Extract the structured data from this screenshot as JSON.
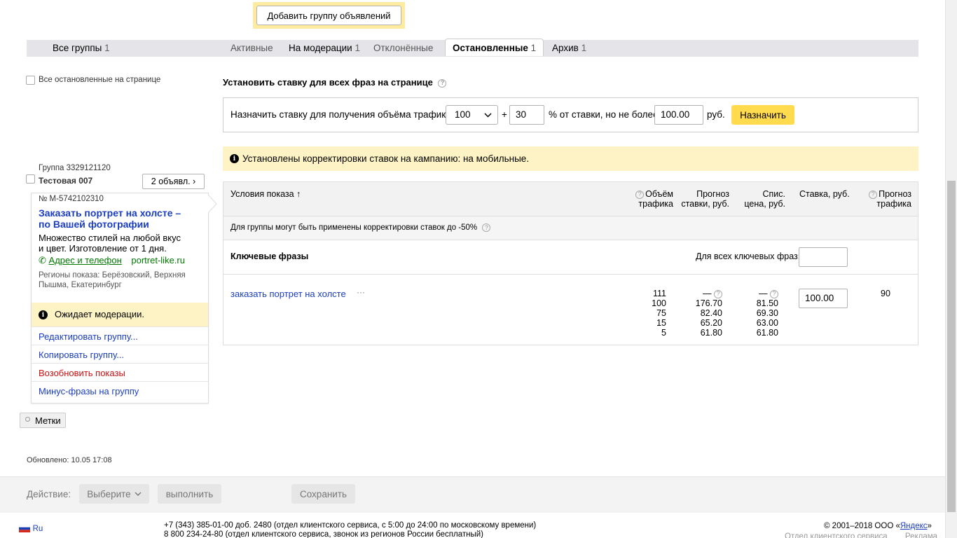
{
  "top": {
    "add_group_label": "Добавить группу объявлений"
  },
  "tabs": {
    "all_label": "Все группы",
    "all_count": "1",
    "active_label": "Активные",
    "moderation_label": "На модерации",
    "moderation_count": "1",
    "rejected_label": "Отклонённые",
    "stopped_label": "Остановленные",
    "stopped_count": "1",
    "archive_label": "Архив",
    "archive_count": "1"
  },
  "select_all_label": "Все остановленные на странице",
  "bid": {
    "title": "Установить ставку для всех фраз на странице",
    "help": "?",
    "assign_label": "Назначить ставку для получения объёма трафика",
    "traffic_value": "100",
    "plus": "+",
    "percent_value": "30",
    "percent_label": "% от ставки, но не более",
    "max_value": "100.00",
    "currency": "руб.",
    "assign_button": "Назначить"
  },
  "notice": {
    "text": "Установлены корректировки ставок на кампанию: на мобильные."
  },
  "table": {
    "col_conditions": "Условия показа ↑",
    "col_volume_1": "Объём",
    "col_volume_2": "трафика",
    "col_forecast_1": "Прогноз",
    "col_forecast_2": "ставки, руб.",
    "col_spis_1": "Спис.",
    "col_spis_2": "цена, руб.",
    "col_bid": "Ставка, руб.",
    "col_traffic_1": "Прогноз",
    "col_traffic_2": "трафика",
    "subheader": "Для группы могут быть применены корректировки ставок до -50%",
    "keywords_label": "Ключевые фразы",
    "all_keywords_label": "Для всех ключевых фраз:",
    "phrase": "заказать портрет на холсте",
    "more": "···",
    "volumes": [
      "111",
      "100",
      "75",
      "15",
      "5"
    ],
    "forecast": [
      "—",
      "176.70",
      "82.40",
      "65.20",
      "61.80"
    ],
    "spis": [
      "—",
      "81.50",
      "69.30",
      "63.00",
      "61.80"
    ],
    "bid_value": "100.00",
    "traffic_forecast": "90"
  },
  "group": {
    "id_label": "Группа 3329121120",
    "name": "Тестовая 007",
    "ads_count": "2 объявл. ›",
    "ad_number": "№ М-5742102310",
    "ad_title_1": "Заказать портрет на холсте –",
    "ad_title_2": "по Вашей фотографии",
    "ad_text_1": "Множество стилей на любой вкус",
    "ad_text_2": "и цвет. Изготовление от 1 дня.",
    "contact_link": "Адрес и телефон",
    "domain": "portret-like.ru",
    "regions_1": "Регионы показа: Берёзовский, Верхняя",
    "regions_2": "Пышма, Екатеринбург",
    "status": "Ожидает модерации.",
    "edit": "Редактировать группу...",
    "copy": "Копировать группу...",
    "resume": "Возобновить показы",
    "minus": "Минус-фразы на группу"
  },
  "tags_label": "Метки",
  "updated": "Обновлено: 10.05 17:08",
  "actions": {
    "action_label": "Действие:",
    "select_label": "Выберите",
    "execute_label": "выполнить",
    "save_label": "Сохранить"
  },
  "footer": {
    "lang": "Ru",
    "phone_1": "+7 (343) 385-01-00 доб. 2480 (отдел клиентского сервиса, с 5:00 до 24:00 по московскому времени)",
    "phone_2": "8 800 234-24-80 (отдел клиентского сервиса, звонок из регионов России бесплатный)",
    "copyright_prefix": "© 2001–2018 ООО «",
    "copyright_link": "Яндекс",
    "copyright_suffix": "»",
    "service_link": "Отдел клиентского сервиса",
    "ads_link": "Реклама"
  },
  "colors": {
    "accent": "#ffdb4d",
    "link": "#1a3dc1",
    "notice": "#fdf3c4",
    "danger": "#cc1111"
  }
}
